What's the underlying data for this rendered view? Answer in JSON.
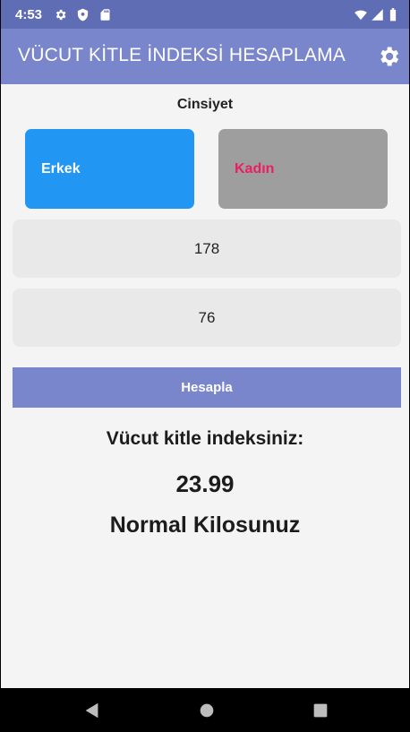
{
  "status_bar": {
    "time": "4:53",
    "icons": [
      "gear-icon",
      "shield-icon",
      "sd-card-icon",
      "wifi-icon",
      "signal-icon",
      "battery-icon"
    ]
  },
  "app_bar": {
    "title": "VÜCUT KİTLE İNDEKSİ HESAPLAMA",
    "settings_icon": "gear-icon",
    "color": "#7986cb"
  },
  "form": {
    "gender_label": "Cinsiyet",
    "male_label": "Erkek",
    "female_label": "Kadın",
    "height_value": "178",
    "weight_value": "76",
    "calculate_label": "Hesapla"
  },
  "result": {
    "label": "Vücut kitle indeksiniz:",
    "value": "23.99",
    "status": "Normal Kilosunuz"
  },
  "colors": {
    "male_selected": "#2196f3",
    "female_unselected": "#9e9e9e",
    "female_text": "#e91e63",
    "accent": "#7986cb"
  },
  "nav_bar": {
    "icons": [
      "back-icon",
      "home-icon",
      "recents-icon"
    ]
  }
}
